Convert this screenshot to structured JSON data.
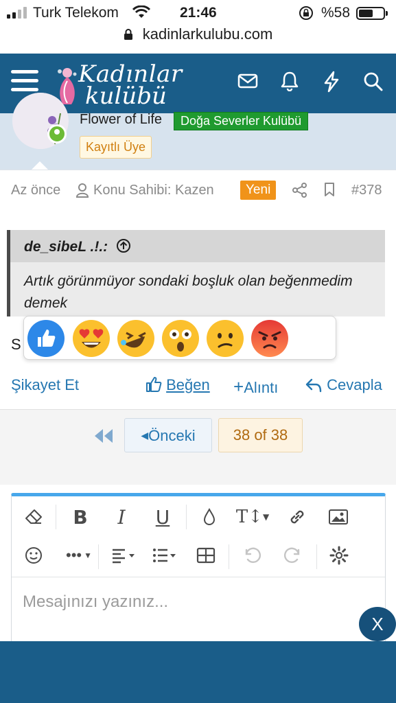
{
  "status_bar": {
    "carrier": "Turk Telekom",
    "time": "21:46",
    "battery": "%58"
  },
  "browser": {
    "url": "kadinlarkulubu.com"
  },
  "header": {
    "logo_line1": "Kadınlar",
    "logo_line2": "kulübü",
    "icons": [
      "menu-icon",
      "envelope-icon",
      "bell-icon",
      "lightning-icon",
      "search-icon"
    ]
  },
  "profile": {
    "username": "Flower of Life",
    "club_badge": "Doğa Severler Kulübü",
    "role_badge": "Kayıtlı Üye"
  },
  "post_meta": {
    "time": "Az önce",
    "thread_owner": "Konu Sahibi: Kazen",
    "new_label": "Yeni",
    "post_number": "#378"
  },
  "quote": {
    "author": "de_sibeL .!.:",
    "text": "Artık görünmüyor sondaki boşluk olan beğenmedim demek"
  },
  "post": {
    "text": "S"
  },
  "reactions": [
    "like",
    "love",
    "haha",
    "wow",
    "sad",
    "angry"
  ],
  "actions": {
    "report": "Şikayet Et",
    "like": "Beğen",
    "quote": "Alıntı",
    "reply": "Cevapla"
  },
  "pagination": {
    "prev_label": "Önceki",
    "page_info": "38 of 38"
  },
  "editor": {
    "placeholder": "Mesajınızı yazınız...",
    "tools": [
      "eraser",
      "bold",
      "italic",
      "underline",
      "color",
      "text-size",
      "link",
      "image",
      "emoji",
      "more",
      "align",
      "list",
      "table",
      "undo",
      "redo",
      "settings"
    ]
  },
  "close_label": "X",
  "colors": {
    "header": "#1a5d89",
    "accent": "#2577b1",
    "editor_top": "#47a7eb",
    "new_badge": "#f0931a",
    "club_badge": "#1f9a2f"
  }
}
